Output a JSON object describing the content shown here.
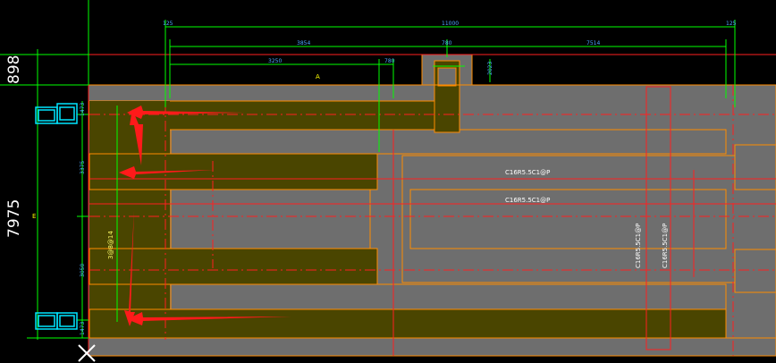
{
  "drawing": {
    "side_dimensions": [
      "898",
      "7975"
    ],
    "top_dimensions": {
      "overall": "11000",
      "left_end": "125",
      "right_end": "125",
      "left_span": "3854",
      "right_span": "7514",
      "notch": "780",
      "inner_left": "3250",
      "inner_right": "780",
      "notch_depth": "2023"
    },
    "left_dimensions": [
      "1473",
      "3375",
      "3050",
      "1473"
    ],
    "beam_labels": [
      "C16R5.5C1@P",
      "C16R5.5C1@P"
    ],
    "vertical_beam_labels": [
      "C16R5.5C1@P",
      "C16R5.5C1@P"
    ],
    "slab_label": "3@8@14",
    "cursor_icon": "crosshair-x-icon",
    "colors": {
      "slab_fill": "#4a4500",
      "beam_fill": "#6e6e6e",
      "outline": "#ff8c00",
      "dimension": "#00ff00",
      "axis": "#ff2020",
      "column": "#00e5ff",
      "arrow": "#ff1a1a",
      "background": "#000000"
    }
  }
}
